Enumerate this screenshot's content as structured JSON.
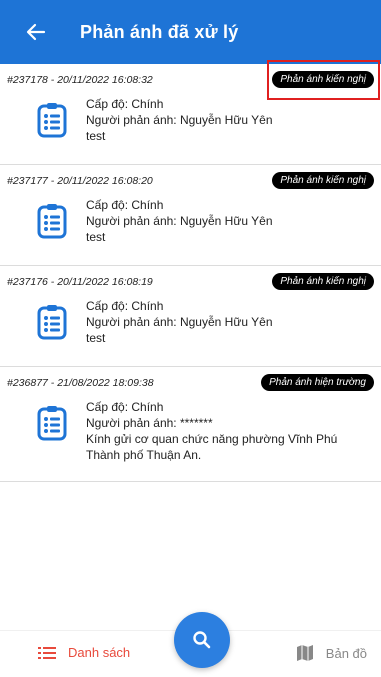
{
  "header": {
    "title": "Phản ánh đã xử lý",
    "back_icon": "arrow-left-icon"
  },
  "colors": {
    "primary": "#1e74d6",
    "accent_red": "#e84a3c",
    "badge_bg": "#000000"
  },
  "items": [
    {
      "meta": "#237178 - 20/11/2022 16:08:32",
      "badge": "Phản ánh kiến nghị",
      "level": "Cấp độ: Chính",
      "reporter": "Người phản ánh: Nguyễn Hữu  Yên",
      "content": [
        "test"
      ]
    },
    {
      "meta": "#237177 - 20/11/2022 16:08:20",
      "badge": "Phản ánh kiến nghị",
      "level": "Cấp độ: Chính",
      "reporter": "Người phản ánh: Nguyễn Hữu  Yên",
      "content": [
        "test"
      ]
    },
    {
      "meta": "#237176 - 20/11/2022 16:08:19",
      "badge": "Phản ánh kiến nghị",
      "level": "Cấp độ: Chính",
      "reporter": "Người phản ánh: Nguyễn Hữu  Yên",
      "content": [
        "test"
      ]
    },
    {
      "meta": "#236877 - 21/08/2022 18:09:38",
      "badge": "Phản ánh hiện trường",
      "level": "Cấp độ: Chính",
      "reporter": "Người phản ánh: *******",
      "content": [
        "Kính gửi cơ quan chức năng phường Vĩnh Phú",
        "Thành phố Thuận An."
      ]
    }
  ],
  "bottom_nav": {
    "list_label": "Danh sách",
    "list_icon": "list-icon",
    "map_label": "Bản đồ",
    "map_icon": "map-icon",
    "search_icon": "search-icon"
  }
}
